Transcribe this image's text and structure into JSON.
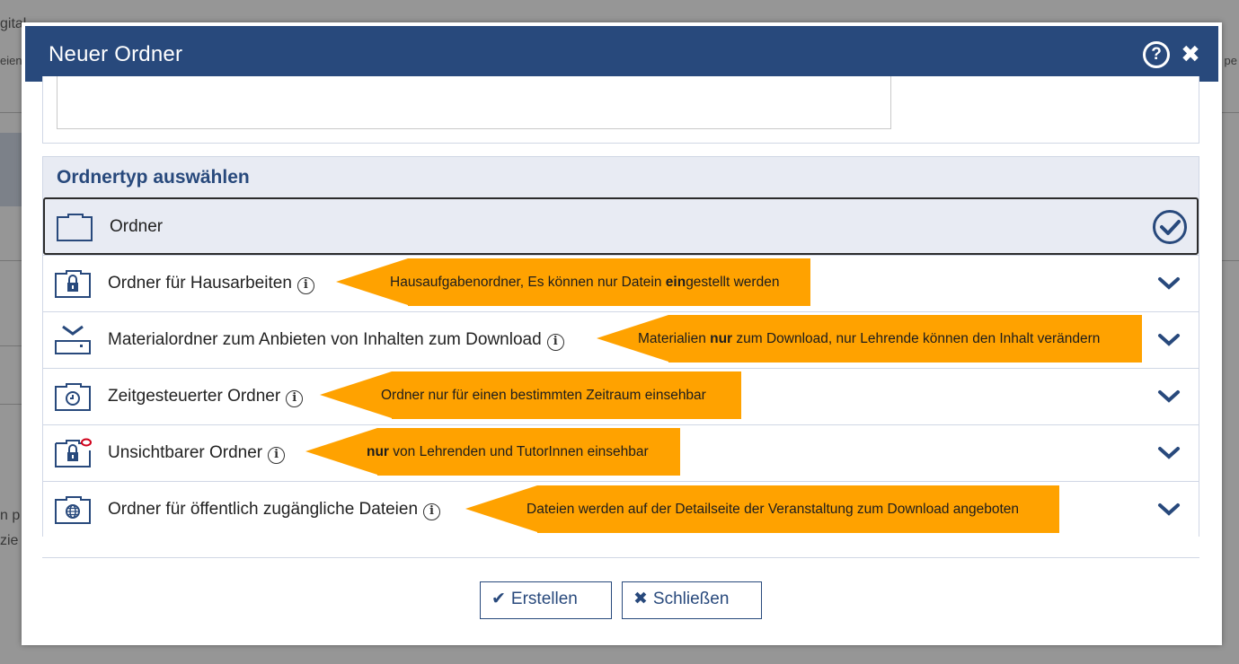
{
  "background": {
    "title_fragment": "gital...",
    "tab_fragment_left": "eien",
    "tab_fragment_right": "pe",
    "side_fragment_1": "n p",
    "side_fragment_2": "zie"
  },
  "dialog": {
    "title": "Neuer Ordner",
    "help_label": "?",
    "close_label": "✖",
    "textarea_value": ""
  },
  "folder_types": {
    "heading": "Ordnertyp auswählen",
    "items": [
      {
        "label": "Ordner",
        "icon": "folder-icon",
        "selected": true,
        "has_info": false
      },
      {
        "label": "Ordner für Hausarbeiten",
        "icon": "homework-folder-icon",
        "selected": false,
        "has_info": true
      },
      {
        "label": "Materialordner zum Anbieten von Inhalten zum Download",
        "icon": "download-folder-icon",
        "selected": false,
        "has_info": true
      },
      {
        "label": "Zeitgesteuerter Ordner",
        "icon": "timed-folder-icon",
        "selected": false,
        "has_info": true
      },
      {
        "label": "Unsichtbarer Ordner",
        "icon": "invisible-folder-icon",
        "selected": false,
        "has_info": true
      },
      {
        "label": "Ordner für öffentlich zugängliche Dateien",
        "icon": "public-folder-icon",
        "selected": false,
        "has_info": true
      }
    ]
  },
  "callouts": {
    "c1": {
      "pre": "Hausaufgabenordner, Es können nur Datein ",
      "bold": "ein",
      "post": "gestellt werden"
    },
    "c2": {
      "pre": "Materialien ",
      "bold": "nur",
      "post": " zum Download, nur Lehrende können den Inhalt verändern"
    },
    "c3": {
      "pre": "Ordner nur für einen bestimmten Zeitraum einsehbar",
      "bold": "",
      "post": ""
    },
    "c4": {
      "pre": "",
      "bold": "nur",
      "post": " von Lehrenden und TutorInnen einsehbar"
    },
    "c5": {
      "pre": "Dateien werden auf der Detailseite der Veranstaltung zum Download angeboten",
      "bold": "",
      "post": ""
    }
  },
  "buttons": {
    "create_icon": "✔",
    "create_label": "Erstellen",
    "close_icon": "✖",
    "close_label": "Schließen"
  },
  "colors": {
    "primary": "#28497c",
    "callout": "#ffa200",
    "header_bg": "#e8ebf3",
    "unsichtbar_accent": "#d0021b"
  }
}
